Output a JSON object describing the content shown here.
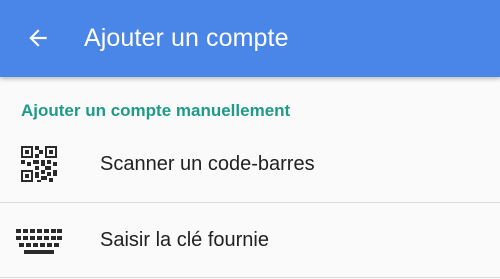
{
  "app_bar": {
    "title": "Ajouter un compte",
    "back_icon": "arrow-left-icon",
    "background": "#4a86e8"
  },
  "section": {
    "header": "Ajouter un compte manuellement",
    "header_color": "#1e9a88"
  },
  "items": [
    {
      "label": "Scanner un code-barres",
      "icon": "qr-code-icon"
    },
    {
      "label": "Saisir la clé fournie",
      "icon": "keyboard-icon"
    }
  ]
}
